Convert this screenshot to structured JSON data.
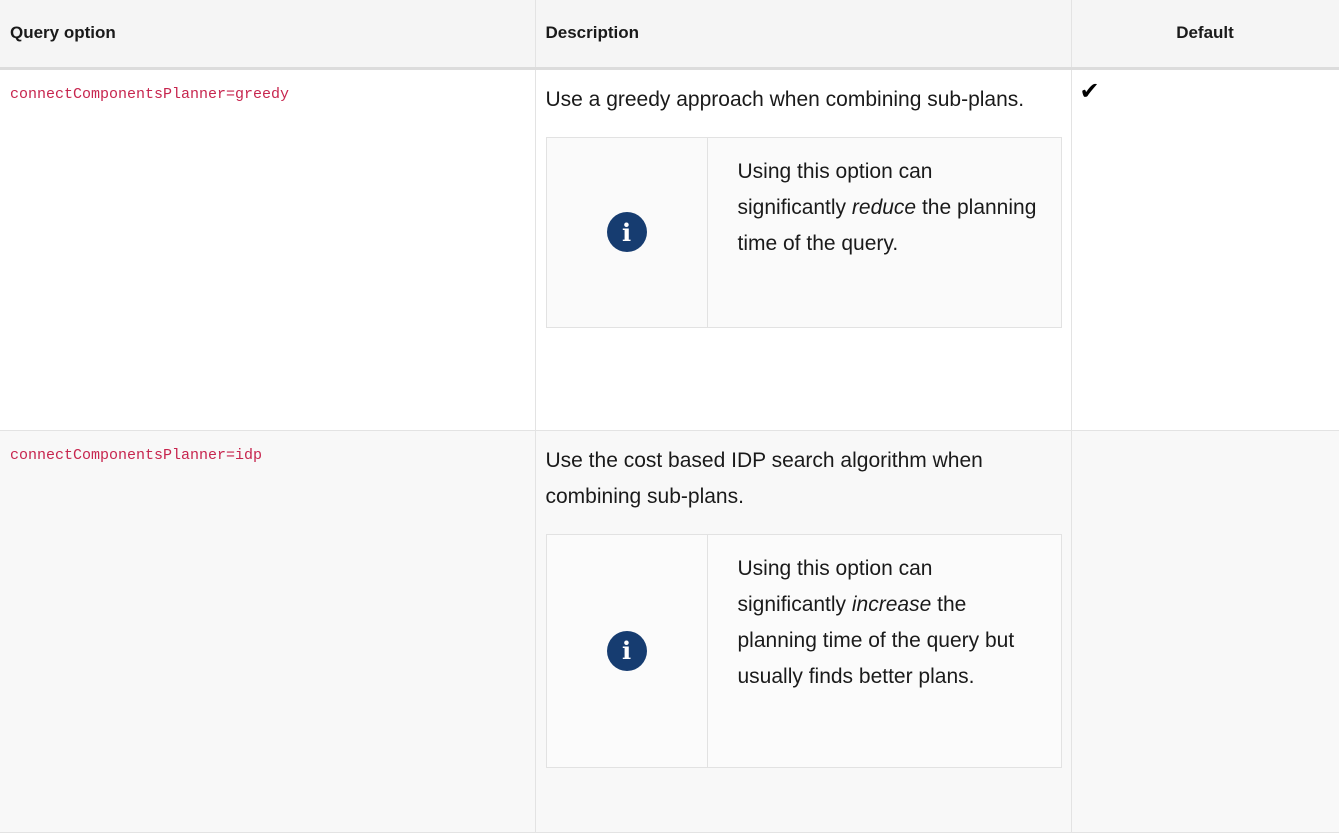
{
  "table": {
    "headers": [
      "Query option",
      "Description",
      "Default"
    ],
    "rows": [
      {
        "option": "connectComponentsPlanner=greedy",
        "description": "Use a greedy approach when combining sub-plans.",
        "note_before": "Using this option can significantly ",
        "note_emphasis": "reduce",
        "note_after": " the planning time of the query.",
        "default": "✔"
      },
      {
        "option": "connectComponentsPlanner=idp",
        "description": "Use the cost based IDP search algorithm when combining sub-plans.",
        "note_before": "Using this option can significantly ",
        "note_emphasis": "increase",
        "note_after": " the planning time of the query but usually finds better plans.",
        "default": ""
      }
    ]
  },
  "icons": {
    "note": "info-icon",
    "default": "check-icon"
  },
  "colors": {
    "option_text": "#c7254e",
    "icon_bg": "#163c70",
    "header_bg": "#f5f5f5"
  }
}
